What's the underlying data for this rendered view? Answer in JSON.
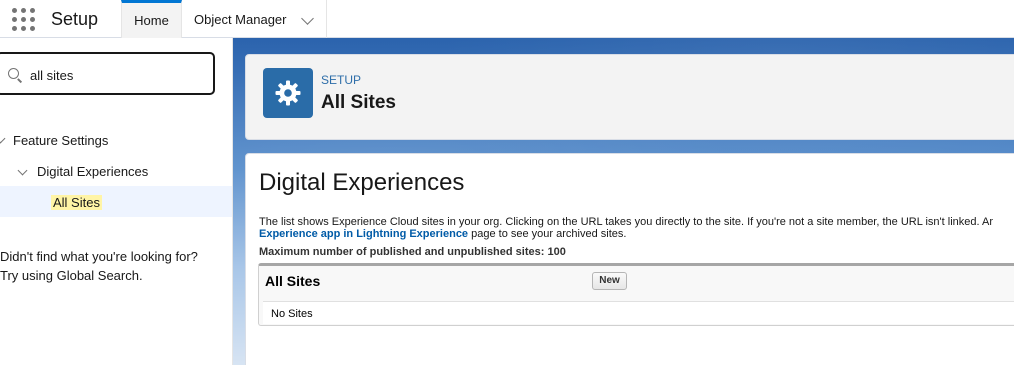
{
  "app": {
    "name": "Setup"
  },
  "tabs": [
    {
      "label": "Home"
    },
    {
      "label": "Object Manager"
    }
  ],
  "sidebar": {
    "search_value": "all sites",
    "tree": [
      {
        "label": "Feature Settings"
      },
      {
        "label": "Digital Experiences"
      },
      {
        "label": "All Sites"
      }
    ],
    "help_line1": "Didn't find what you're looking for?",
    "help_line2": "Try using Global Search."
  },
  "header": {
    "breadcrumb": "SETUP",
    "title": "All Sites"
  },
  "main": {
    "title": "Digital Experiences",
    "desc_line1": "The list shows Experience Cloud sites in your org. Clicking on the URL takes you directly to the site. If you're not a site member, the URL isn't linked. Ar",
    "desc_link": "Experience app in Lightning Experience",
    "desc_line2_rest": " page to see your archived sites.",
    "max_sites": "Maximum number of published and unpublished sites: 100",
    "list_title": "All Sites",
    "new_button": "New",
    "empty_text": "No Sites"
  },
  "colors": {
    "brand_blue": "#0176d3",
    "gear_tile": "#2a6ca8",
    "link": "#015ba7",
    "highlight": "#fff4a6"
  }
}
